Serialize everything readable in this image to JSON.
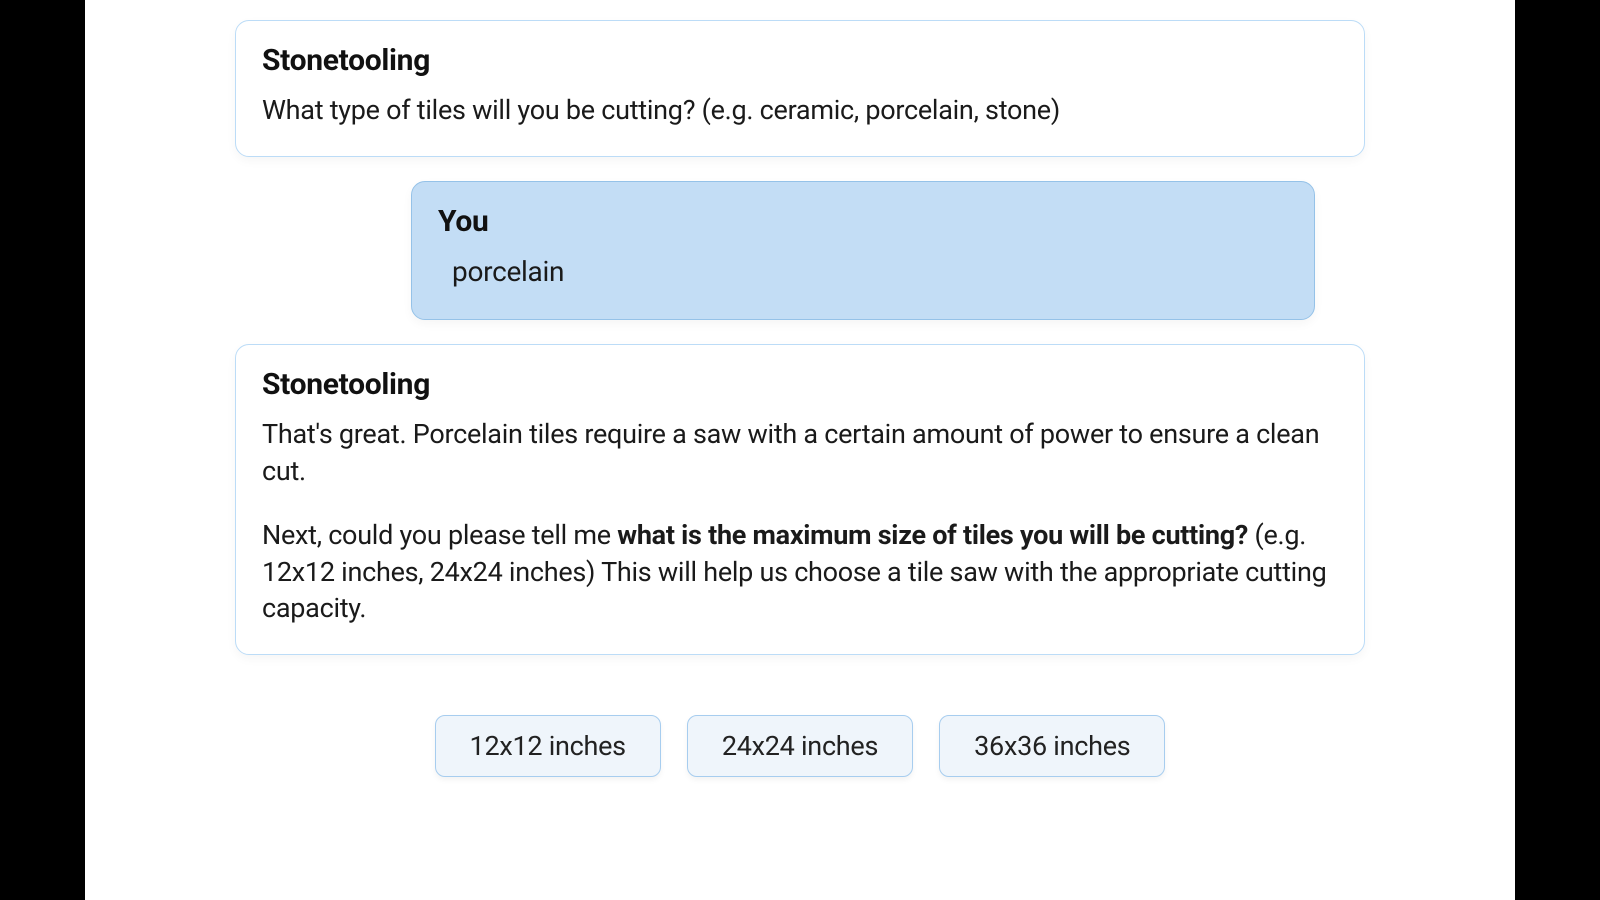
{
  "speakers": {
    "assistant": "Stonetooling",
    "user": "You"
  },
  "messages": {
    "m1": "What type of tiles will you be cutting? (e.g. ceramic, porcelain, stone)",
    "m2": "porcelain",
    "m3_p1": "That's great. Porcelain tiles require a saw with a certain amount of power to ensure a clean cut.",
    "m3_p2a": "Next, could you please tell me ",
    "m3_p2b": "what is the maximum size of tiles you will be cutting?",
    "m3_p2c": " (e.g. 12x12 inches, 24x24 inches) This will help us choose a tile saw with the appropriate cutting capacity."
  },
  "quick_replies": {
    "r1": "12x12 inches",
    "r2": "24x24 inches",
    "r3": "36x36 inches"
  }
}
